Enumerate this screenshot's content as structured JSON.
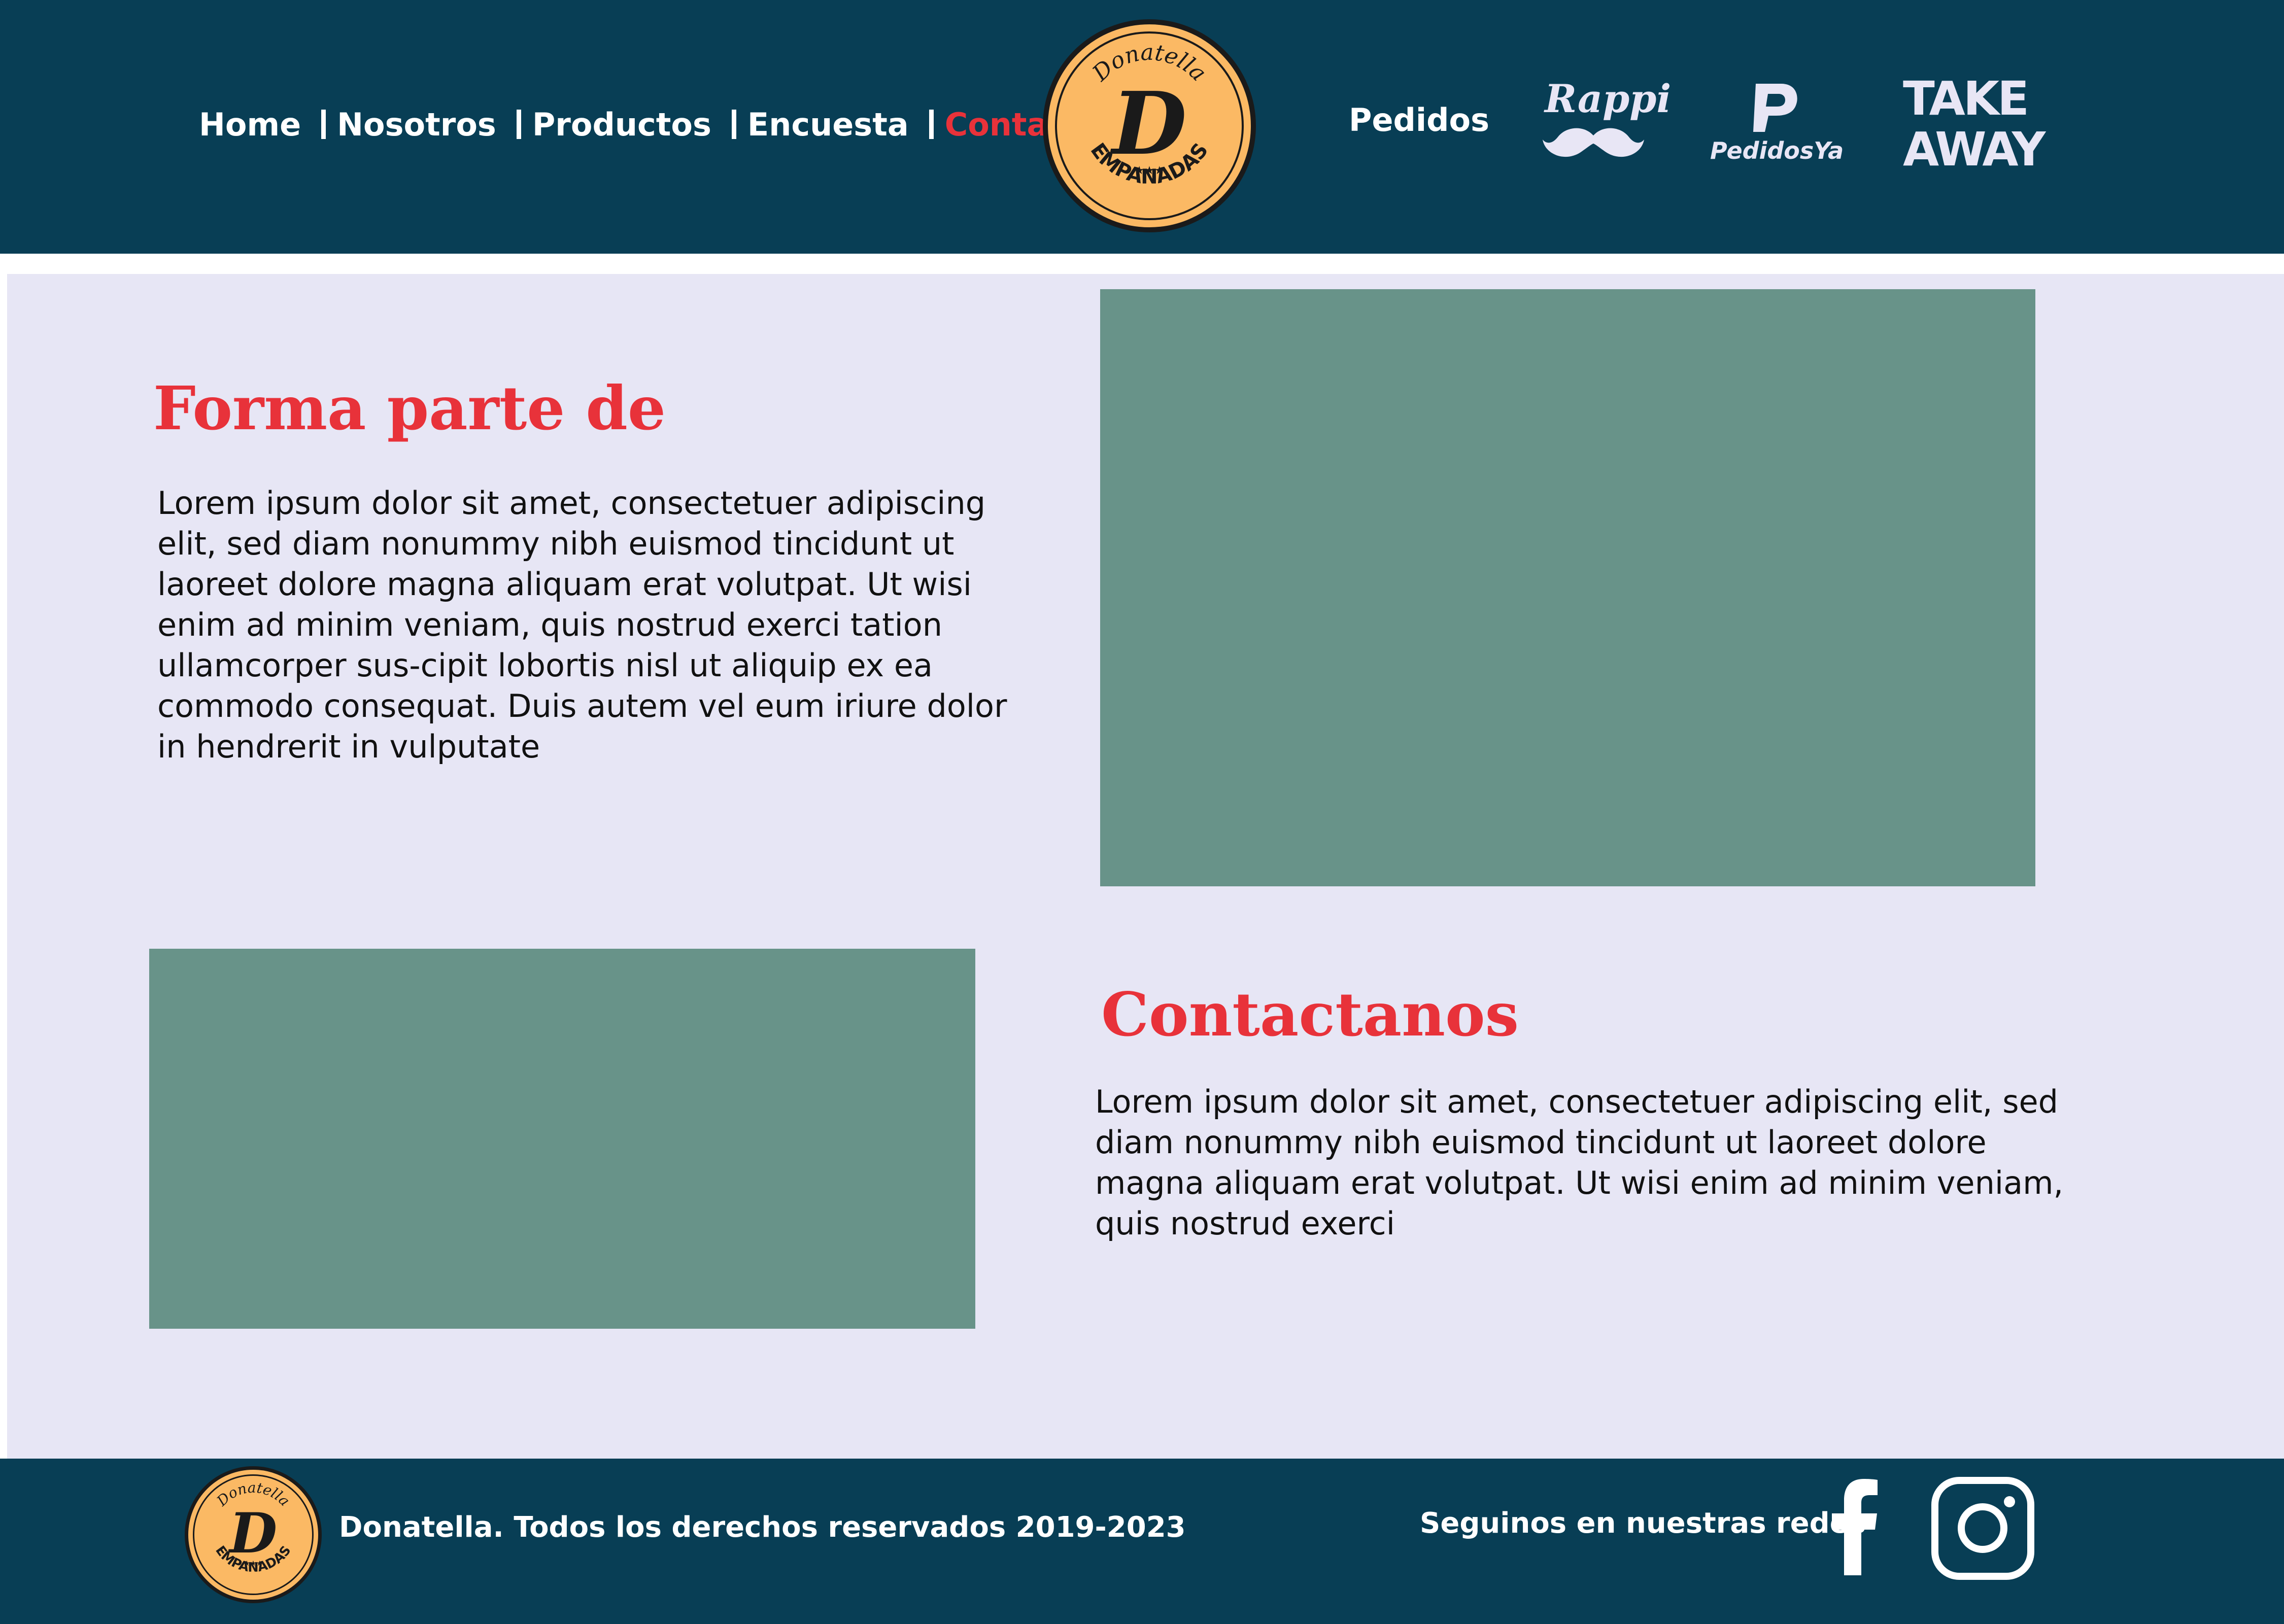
{
  "nav": {
    "items": [
      {
        "label": "Home"
      },
      {
        "label": "Nosotros"
      },
      {
        "label": "Productos"
      },
      {
        "label": "Encuesta"
      },
      {
        "label": "Contacto"
      }
    ],
    "active": "Contacto"
  },
  "logo": {
    "top_text": "Donatella",
    "letter": "D",
    "bottom_text": "EMPANADAS",
    "stars": "★★★"
  },
  "delivery": {
    "label": "Pedidos",
    "rappi": "Rappi",
    "pedidosya": "PedidosYa",
    "takeaway_line1": "TAKE",
    "takeaway_line2": "AWAY"
  },
  "section1": {
    "title": "Forma parte de",
    "body": "Lorem ipsum dolor sit amet, consectetuer adipiscing elit, sed diam nonummy nibh euismod tincidunt ut laoreet dolore magna aliquam erat volutpat. Ut wisi enim ad minim veniam, quis nostrud exerci tation ullamcorper sus-cipit lobortis nisl ut aliquip ex ea commodo consequat. Duis autem vel eum iriure dolor in hendrerit in vulputate"
  },
  "section2": {
    "title": "Contactanos",
    "body": "Lorem ipsum dolor sit amet, consectetuer adipiscing elit, sed diam nonummy nibh euismod tincidunt ut laoreet dolore magna aliquam erat volutpat. Ut wisi enim ad minim veniam, quis nostrud exerci"
  },
  "footer": {
    "copyright": "Donatella. Todos los derechos reservados 2019-2023",
    "social_label": "Seguinos en nuestras redes"
  },
  "icons": [
    "facebook-icon",
    "instagram-icon",
    "mustache-icon",
    "pedidosya-p-icon"
  ],
  "colors": {
    "header_bg": "#083e55",
    "content_bg": "#e7e6f5",
    "accent_red": "#e8323a",
    "placeholder": "#689389",
    "logo_gold": "#fbb964"
  }
}
